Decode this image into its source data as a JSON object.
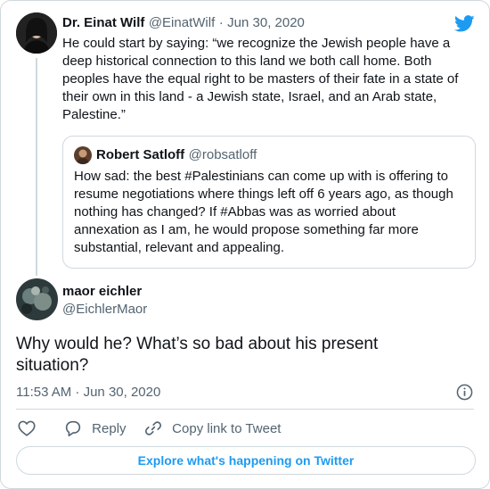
{
  "colors": {
    "twitter_blue": "#1d9bf0",
    "text": "#0f1419",
    "muted": "#536471",
    "border": "#cfd9de"
  },
  "icons": [
    "twitter-bird-icon",
    "info-icon",
    "heart-icon",
    "reply-icon",
    "link-icon"
  ],
  "parent_tweet": {
    "author_name": "Dr. Einat Wilf",
    "handle": "@EinatWilf",
    "separator": "·",
    "date": "Jun 30, 2020",
    "lines": [
      "He could start by saying: “we recognize the Jewish people have a",
      "deep historical connection to this land we both call home. Both",
      "peoples have the equal right to be masters of their fate in a state of",
      "their own in this land - a Jewish state, Israel, and an Arab state,",
      "Palestine.”"
    ]
  },
  "quoted_tweet": {
    "author_name": "Robert Satloff",
    "handle": "@robsatloff",
    "lines": [
      "How sad: the best #Palestinians can come up with is offering to",
      "resume negotiations where things left off 6 years ago, as though",
      "nothing has changed? If #Abbas was as worried about",
      "annexation as I am, he would propose something far more",
      "substantial, relevant and appealing."
    ]
  },
  "main_tweet": {
    "author_name": "maor eichler",
    "handle": "@EichlerMaor",
    "lines": [
      "Why would he? What’s so bad about his present",
      "situation?"
    ],
    "timestamp": "11:53 AM · Jun 30, 2020"
  },
  "actions": {
    "reply_label": "Reply",
    "copy_link_label": "Copy link to Tweet"
  },
  "explore_button_label": "Explore what's happening on Twitter"
}
